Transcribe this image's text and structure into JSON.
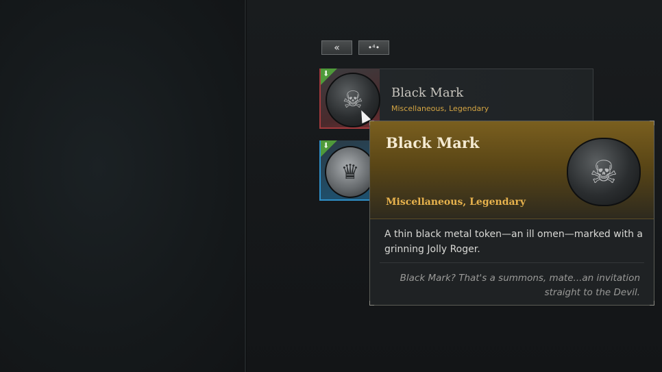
{
  "toolbar": {
    "collapse_glyph": "«",
    "toggle_glyph": "•⁴•"
  },
  "inventory": {
    "selected_item": {
      "name": "Black Mark",
      "subtitle": "Miscellaneous, Legendary",
      "slot_color": "#a23a3d"
    },
    "second_item": {
      "slot_color": "#2f8fc7"
    },
    "badge_glyph": "⬇"
  },
  "tooltip": {
    "title": "Black Mark",
    "subtitle": "Miscellaneous, Legendary",
    "description": "A thin black metal token—an ill omen—marked with a grinning Jolly Roger.",
    "quote": "Black Mark? That's a summons, mate...an invitation straight to the Devil.",
    "header_color": "#7a5f1f",
    "rarity_color": "#e7b24d"
  },
  "icons": {
    "skull_glyph": "☠",
    "coin_glyph": "♛"
  }
}
